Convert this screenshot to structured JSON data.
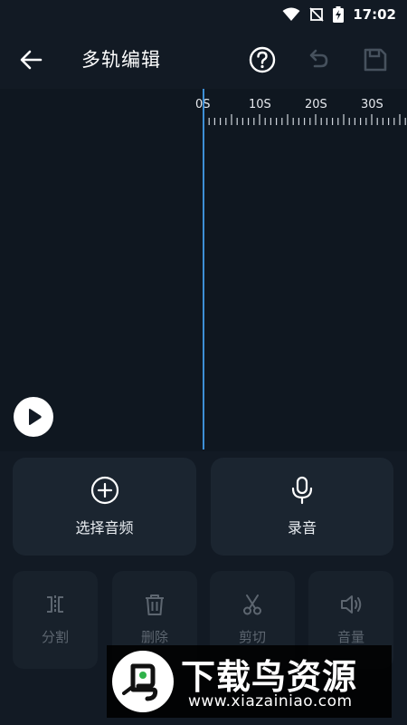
{
  "status_bar": {
    "time": "17:02",
    "icons": [
      "wifi-icon",
      "no-sim-icon",
      "battery-charging-icon"
    ]
  },
  "app_bar": {
    "title": "多轨编辑",
    "icons": [
      "back-arrow-icon",
      "help-icon",
      "undo-icon",
      "save-icon"
    ]
  },
  "timeline": {
    "ruler_labels": [
      "0S",
      "10S",
      "20S",
      "30S"
    ],
    "playhead_time_s": 0,
    "play_icon": "play-icon"
  },
  "actions": {
    "select_audio": {
      "label": "选择音频",
      "icon": "add-circle-icon"
    },
    "record": {
      "label": "录音",
      "icon": "microphone-icon"
    }
  },
  "tools": [
    {
      "label": "分割",
      "icon": "split-icon"
    },
    {
      "label": "删除",
      "icon": "trash-icon"
    },
    {
      "label": "剪切",
      "icon": "scissors-icon"
    },
    {
      "label": "音量",
      "icon": "volume-icon"
    }
  ],
  "watermark": {
    "title": "下载鸟资源",
    "url": "www.xiazainiao.com"
  },
  "colors": {
    "background": "#121a24",
    "track_background": "#0f1720",
    "card": "#1b2530",
    "playhead": "#3d8fd6",
    "disabled_text": "#5d6670"
  }
}
